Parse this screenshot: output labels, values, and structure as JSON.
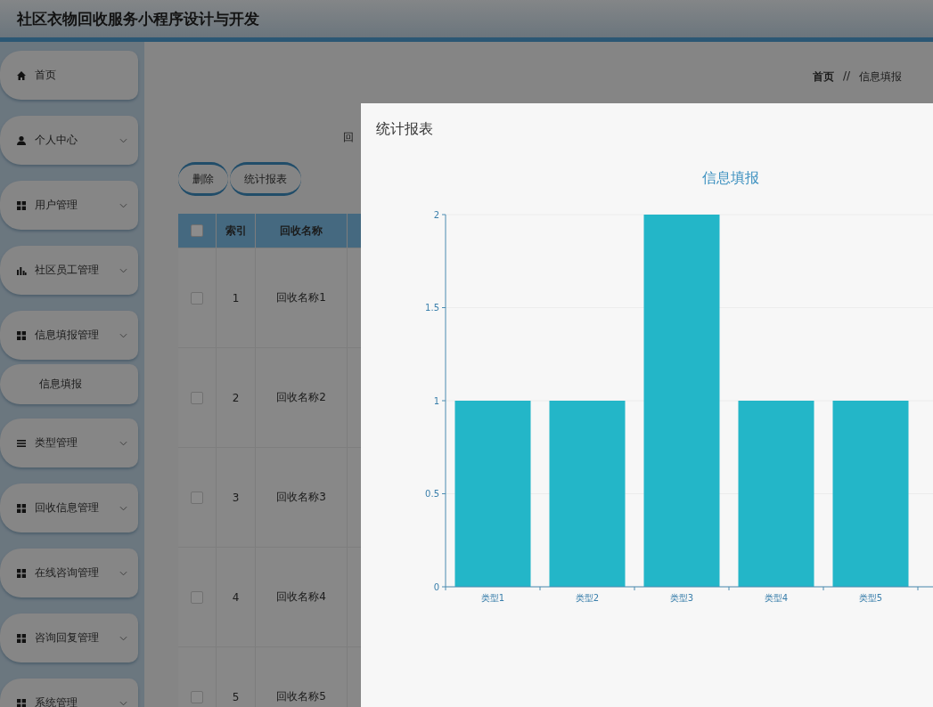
{
  "header": {
    "title": "社区衣物回收服务小程序设计与开发"
  },
  "sidebar": {
    "items": [
      {
        "label": "首页",
        "kind": "link"
      },
      {
        "label": "个人中心",
        "kind": "menu"
      },
      {
        "label": "用户管理",
        "kind": "menu"
      },
      {
        "label": "社区员工管理",
        "kind": "menu"
      },
      {
        "label": "信息填报管理",
        "kind": "menu",
        "children": [
          {
            "label": "信息填报"
          }
        ]
      },
      {
        "label": "类型管理",
        "kind": "menu"
      },
      {
        "label": "回收信息管理",
        "kind": "menu"
      },
      {
        "label": "在线咨询管理",
        "kind": "menu"
      },
      {
        "label": "咨询回复管理",
        "kind": "menu"
      },
      {
        "label": "系统管理",
        "kind": "menu"
      }
    ]
  },
  "breadcrumb": [
    "首页",
    "//",
    "信息填报"
  ],
  "search": {
    "label": "回"
  },
  "buttons": [
    "删除",
    "统计报表"
  ],
  "table": {
    "select_all": {
      "checked": false
    },
    "columns": [
      "索引",
      "回收名称"
    ],
    "rows": [
      {
        "checked": false,
        "index": "1",
        "name": "回收名称1"
      },
      {
        "checked": false,
        "index": "2",
        "name": "回收名称2"
      },
      {
        "checked": false,
        "index": "3",
        "name": "回收名称3"
      },
      {
        "checked": false,
        "index": "4",
        "name": "回收名称4"
      },
      {
        "checked": false,
        "index": "5",
        "name": "回收名称5"
      }
    ]
  },
  "dialog": {
    "title": "统计报表",
    "chart_data": {
      "type": "bar",
      "title": "信息填报",
      "categories": [
        "类型1",
        "类型2",
        "类型3",
        "类型4",
        "类型5"
      ],
      "values": [
        1,
        1,
        2,
        1,
        1
      ],
      "ylim": [
        0,
        2
      ],
      "grid": true,
      "yticks": [
        0,
        0.5,
        1,
        1.5,
        2
      ]
    }
  }
}
